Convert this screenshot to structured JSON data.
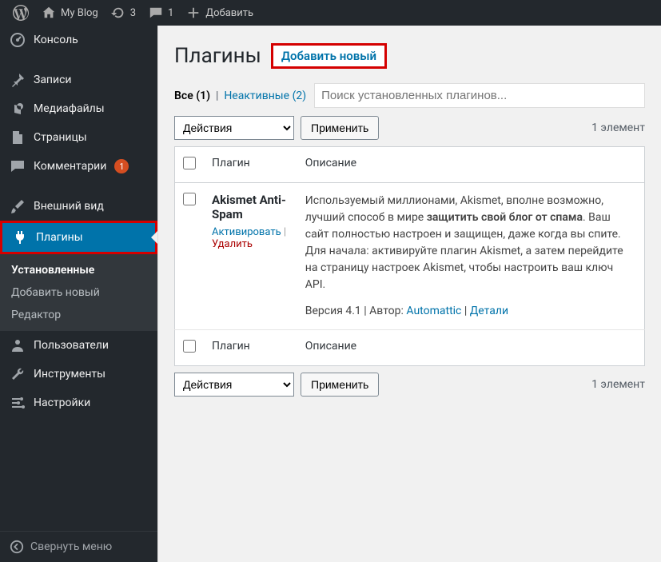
{
  "adminbar": {
    "site_name": "My Blog",
    "updates_count": "3",
    "comments_count": "1",
    "add_new": "Добавить"
  },
  "sidebar": {
    "items": [
      {
        "label": "Консоль"
      },
      {
        "label": "Записи"
      },
      {
        "label": "Медиафайлы"
      },
      {
        "label": "Страницы"
      },
      {
        "label": "Комментарии",
        "badge": "1"
      },
      {
        "label": "Внешний вид"
      },
      {
        "label": "Плагины"
      },
      {
        "label": "Пользователи"
      },
      {
        "label": "Инструменты"
      },
      {
        "label": "Настройки"
      }
    ],
    "submenu": [
      {
        "label": "Установленные"
      },
      {
        "label": "Добавить новый"
      },
      {
        "label": "Редактор"
      }
    ],
    "collapse": "Свернуть меню"
  },
  "page": {
    "title": "Плагины",
    "add_new": "Добавить новый",
    "filters": {
      "all_label": "Все",
      "all_count": "(1)",
      "inactive_label": "Неактивные",
      "inactive_count": "(2)"
    },
    "search_placeholder": "Поиск установленных плагинов...",
    "bulk_action": "Действия",
    "apply": "Применить",
    "items_count": "1 элемент",
    "columns": {
      "plugin": "Плагин",
      "description": "Описание"
    },
    "plugin": {
      "name": "Akismet Anti-Spam",
      "activate": "Активировать",
      "delete": "Удалить",
      "desc_pre": "Используемый миллионами, Akismet, вполне возможно, лучший способ в мире ",
      "desc_bold": "защитить свой блог от спама",
      "desc_post": ". Ваш сайт полностью настроен и защищен, даже когда вы спите. Для начала: активируйте плагин Akismet, а затем перейдите на страницу настроек Akismet, чтобы настроить ваш ключ API.",
      "version_label": "Версия 4.1",
      "author_label": "Автор:",
      "author": "Automattic",
      "details": "Детали"
    }
  }
}
